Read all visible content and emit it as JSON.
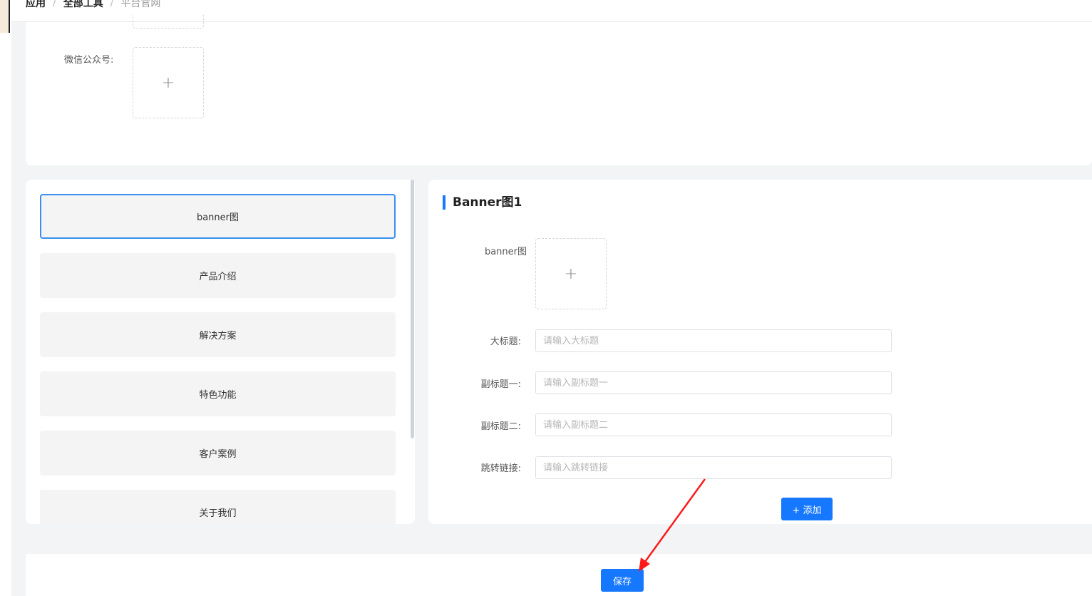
{
  "breadcrumb": {
    "items": [
      "应用",
      "全部工具"
    ],
    "separator": "/",
    "current": "平台官网"
  },
  "top_section": {
    "wechat_label": "微信公众号:",
    "upload_icon": "plus-icon"
  },
  "nav": {
    "items": [
      {
        "label": "banner图",
        "active": true
      },
      {
        "label": "产品介绍",
        "active": false
      },
      {
        "label": "解决方案",
        "active": false
      },
      {
        "label": "特色功能",
        "active": false
      },
      {
        "label": "客户案例",
        "active": false
      },
      {
        "label": "关于我们",
        "active": false
      }
    ]
  },
  "form": {
    "section_title": "Banner图1",
    "banner_label": "banner图",
    "fields": [
      {
        "label": "大标题:",
        "placeholder": "请输入大标题",
        "value": ""
      },
      {
        "label": "副标题一:",
        "placeholder": "请输入副标题一",
        "value": ""
      },
      {
        "label": "副标题二:",
        "placeholder": "请输入副标题二",
        "value": ""
      },
      {
        "label": "跳转链接:",
        "placeholder": "请输入跳转链接",
        "value": ""
      }
    ],
    "add_label": "+ 添加"
  },
  "footer": {
    "save_label": "保存"
  },
  "colors": {
    "primary": "#1677ff",
    "annotation_arrow": "#ff1a1a",
    "active_border": "#3b8ef0"
  }
}
